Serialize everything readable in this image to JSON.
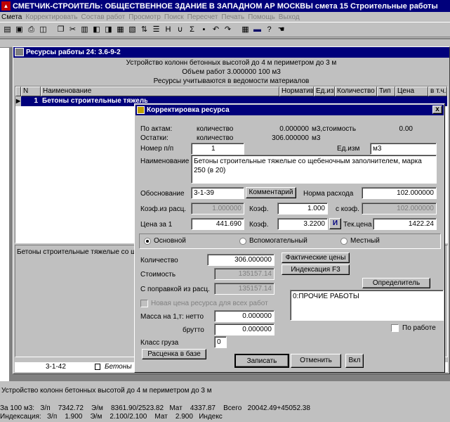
{
  "app": {
    "title": "СМЕТЧИК-СТРОИТЕЛЬ: ОБЩЕСТВЕННОЕ ЗДАНИЕ В ЗАПАДНОМ АР МОСКВЫ смета 15 Строительные работы"
  },
  "menu": [
    {
      "label": "Смета",
      "enabled": true
    },
    {
      "label": "Корректировать",
      "enabled": false
    },
    {
      "label": "Состав работ",
      "enabled": false
    },
    {
      "label": "Просмотр",
      "enabled": false
    },
    {
      "label": "Поиск",
      "enabled": false
    },
    {
      "label": "Пересчет",
      "enabled": false
    },
    {
      "label": "Печать",
      "enabled": false
    },
    {
      "label": "Помощь",
      "enabled": false
    },
    {
      "label": "Выход",
      "enabled": false
    }
  ],
  "toolbar_icons": [
    "open-icon",
    "save-icon",
    "print-icon",
    "preview-icon",
    "copy-icon",
    "cut-icon",
    "paste-icon",
    "find-icon",
    "replace-icon",
    "calc-icon",
    "table-icon",
    "sort-icon",
    "filter-icon",
    "sum-icon",
    "h-icon",
    "union-icon",
    "sigma-icon",
    "disk-icon",
    "undo-icon",
    "redo-icon",
    "grid-icon",
    "chart-icon",
    "help-icon",
    "pointer-icon"
  ],
  "resources_window": {
    "title": "Ресурсы работы 24: 3.6-9-2",
    "header_line1": "Устройство колонн бетонных высотой до 4 м периметром до 3 м",
    "header_line2": "Объем работ      3.000000 100 м3",
    "header_line3": "Ресурсы учитываются в ведомости материалов",
    "columns": [
      "N",
      "Наименование",
      "Норматив",
      "Ед.из",
      "Количество",
      "Тип",
      "Цена",
      "в т.ч.з"
    ],
    "row1": {
      "n": "1",
      "name": "Бетоны строительные тяжелые со щебеночным заполнителем"
    },
    "bottom_row": {
      "code": "3-1-42",
      "name": "Бетоны"
    },
    "bottom_text": "Бетоны строительные тяжелые со щ"
  },
  "dialog": {
    "title": "Корректировка ресурса",
    "by_acts_label": "По актам:",
    "by_acts_qty_label": "количество",
    "by_acts_qty": "0.000000",
    "by_acts_unit": "м3,стоимость",
    "by_acts_cost": "0.00",
    "rest_label": "Остатки:",
    "rest_qty_label": "количество",
    "rest_qty": "306.000000",
    "rest_unit": "м3",
    "num_label": "Номер п/п",
    "num_value": "1",
    "unit_label": "Ед.изм",
    "unit_value": "м3",
    "name_label": "Наименование",
    "name_value": "Бетоны строительные тяжелые со щебеночным заполнителем, марка 250 (в 20)",
    "basis_label": "Обоснование",
    "basis_value": "3-1-39",
    "comment_button": "Комментарий",
    "norm_label": "Норма расхода",
    "norm_value": "102.000000",
    "coef_calc_label": "Коэф.из расц.",
    "coef_calc_value": "1.000000",
    "coef_label": "Коэф.",
    "coef_value": "1.000",
    "with_coef_label": "с коэф.",
    "with_coef_value": "102.000000",
    "price_label": "Цена за 1",
    "price_value": "441.690",
    "coef2_label": "Коэф.",
    "coef2_value": "3.2200",
    "i_button": "И",
    "cur_price_label": "Тек.цена",
    "cur_price_value": "1422.24",
    "radio_main": "Основной",
    "radio_aux": "Вспомогательный",
    "radio_local": "Местный",
    "qty_label": "Количество",
    "qty_value": "306.000000",
    "cost_label": "Стоимость",
    "cost_value": "135157.14",
    "corr_label": "С поправкой из расц.",
    "corr_value": "135157.14",
    "new_price_label": "Новая цена ресурса для всех работ",
    "fact_prices_button": "Фактические цены",
    "index_button": "Индексация F3",
    "determinant_button": "Определитель",
    "determinant_value": "0:ПРОЧИЕ РАБОТЫ",
    "mass_label": "Масса на 1,т: нетто",
    "mass_net": "0.000000",
    "gross_label": "брутто",
    "mass_gross": "0.000000",
    "cargo_label": "Класс груза",
    "cargo_value": "0",
    "base_price_button": "Расценка в базе",
    "by_work_label": "По работе",
    "save_button": "Записать",
    "cancel_button": "Отменить",
    "incl_button": "Вкл",
    "close_symbol": "x"
  },
  "status": {
    "line1": "Устройство колонн бетонных высотой до 4 м периметром до 3 м",
    "line2": "За 100 м3:   З/п    7342.72    Э/м    8361.90/2523.82   Мат    4337.87    Всего   20042.49+45052.38",
    "line3": "Индексация:   З/п    1.900    Э/м    2.100/2.100    Мат    2.900   Индекс"
  }
}
